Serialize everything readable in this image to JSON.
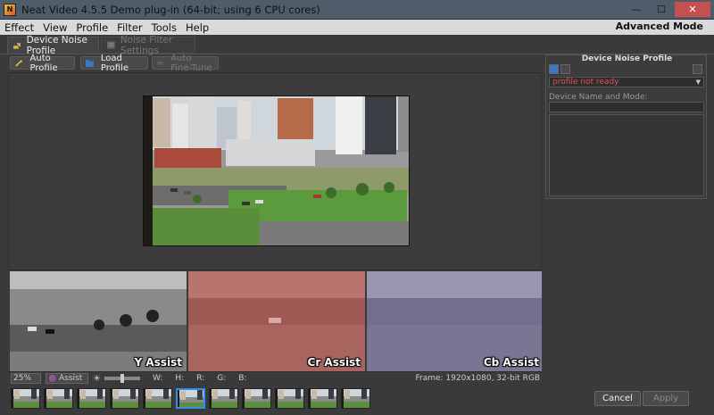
{
  "window": {
    "title": "Neat Video 4.5.5 Demo plug-in (64-bit; using 6 CPU cores)",
    "minimize": "—",
    "maximize": "☐",
    "close": "✕"
  },
  "menu": [
    "Effect",
    "View",
    "Profile",
    "Filter",
    "Tools",
    "Help"
  ],
  "mode": "Advanced Mode",
  "tabs": [
    {
      "label": "Device Noise Profile",
      "active": true
    },
    {
      "label": "Noise Filter Settings",
      "active": false
    }
  ],
  "toolbar": {
    "auto_profile": "Auto Profile",
    "load_profile": "Load Profile",
    "auto_fine_tune": "Auto Fine-Tune"
  },
  "assist": {
    "y": "Y Assist",
    "cr": "Cr Assist",
    "cb": "Cb Assist"
  },
  "status": {
    "zoom": "25%",
    "assist_mode": "Assist",
    "w": "W:",
    "h": "H:",
    "r": "R:",
    "g": "G:",
    "b": "B:",
    "frame": "Frame: 1920x1080, 32-bit RGB"
  },
  "right_panel": {
    "title": "Device Noise Profile",
    "profile_status": "profile not ready",
    "device_label": "Device Name and Mode:",
    "status_color": "#e05050"
  },
  "buttons": {
    "cancel": "Cancel",
    "apply": "Apply"
  },
  "thumbnails": {
    "count": 11,
    "selected_index": 5
  },
  "colors": {
    "accent": "#2d8ef3",
    "close": "#c75050"
  }
}
